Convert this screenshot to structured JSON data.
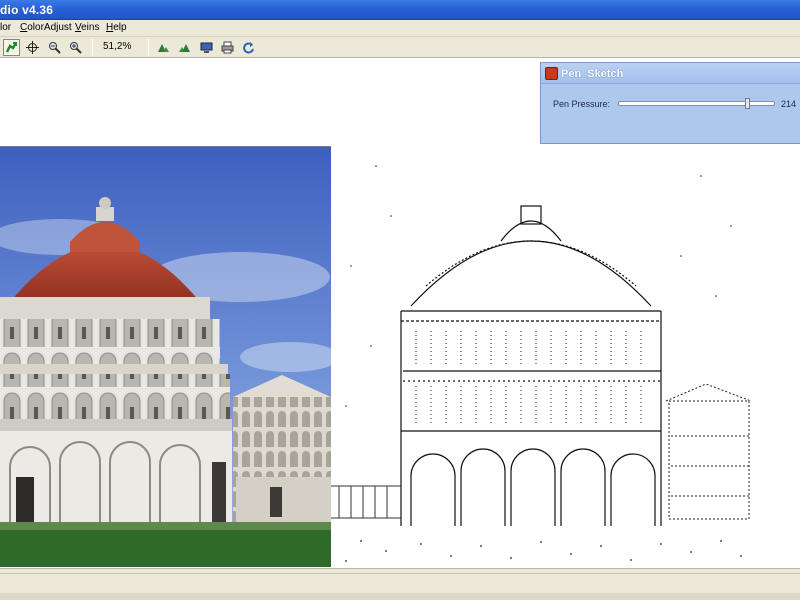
{
  "window": {
    "title": "dio v4.36"
  },
  "menu": {
    "items": [
      {
        "label": "lor",
        "underline": ""
      },
      {
        "label": "olorAdjust",
        "underline": "C"
      },
      {
        "label": "eins",
        "underline": "V"
      },
      {
        "label": "elp",
        "underline": "H"
      }
    ]
  },
  "toolbar": {
    "zoom": "51,2%",
    "buttons": [
      "green-arrow-icon",
      "crosshair-icon",
      "zoom-out-icon",
      "zoom-in-icon",
      "mountain-left-icon",
      "mountain-right-icon",
      "monitor-icon",
      "print-icon",
      "refresh-icon"
    ]
  },
  "panel": {
    "title": "Pen_Sketch",
    "label": "Pen Pressure:",
    "value": "214",
    "value_fraction": 0.84
  },
  "colors": {
    "titlebar": "#2a63d6",
    "panel": "#aec7ec",
    "sky": "#4f6fc7",
    "grass": "#2f6a2a",
    "dome": "#b5412d"
  }
}
